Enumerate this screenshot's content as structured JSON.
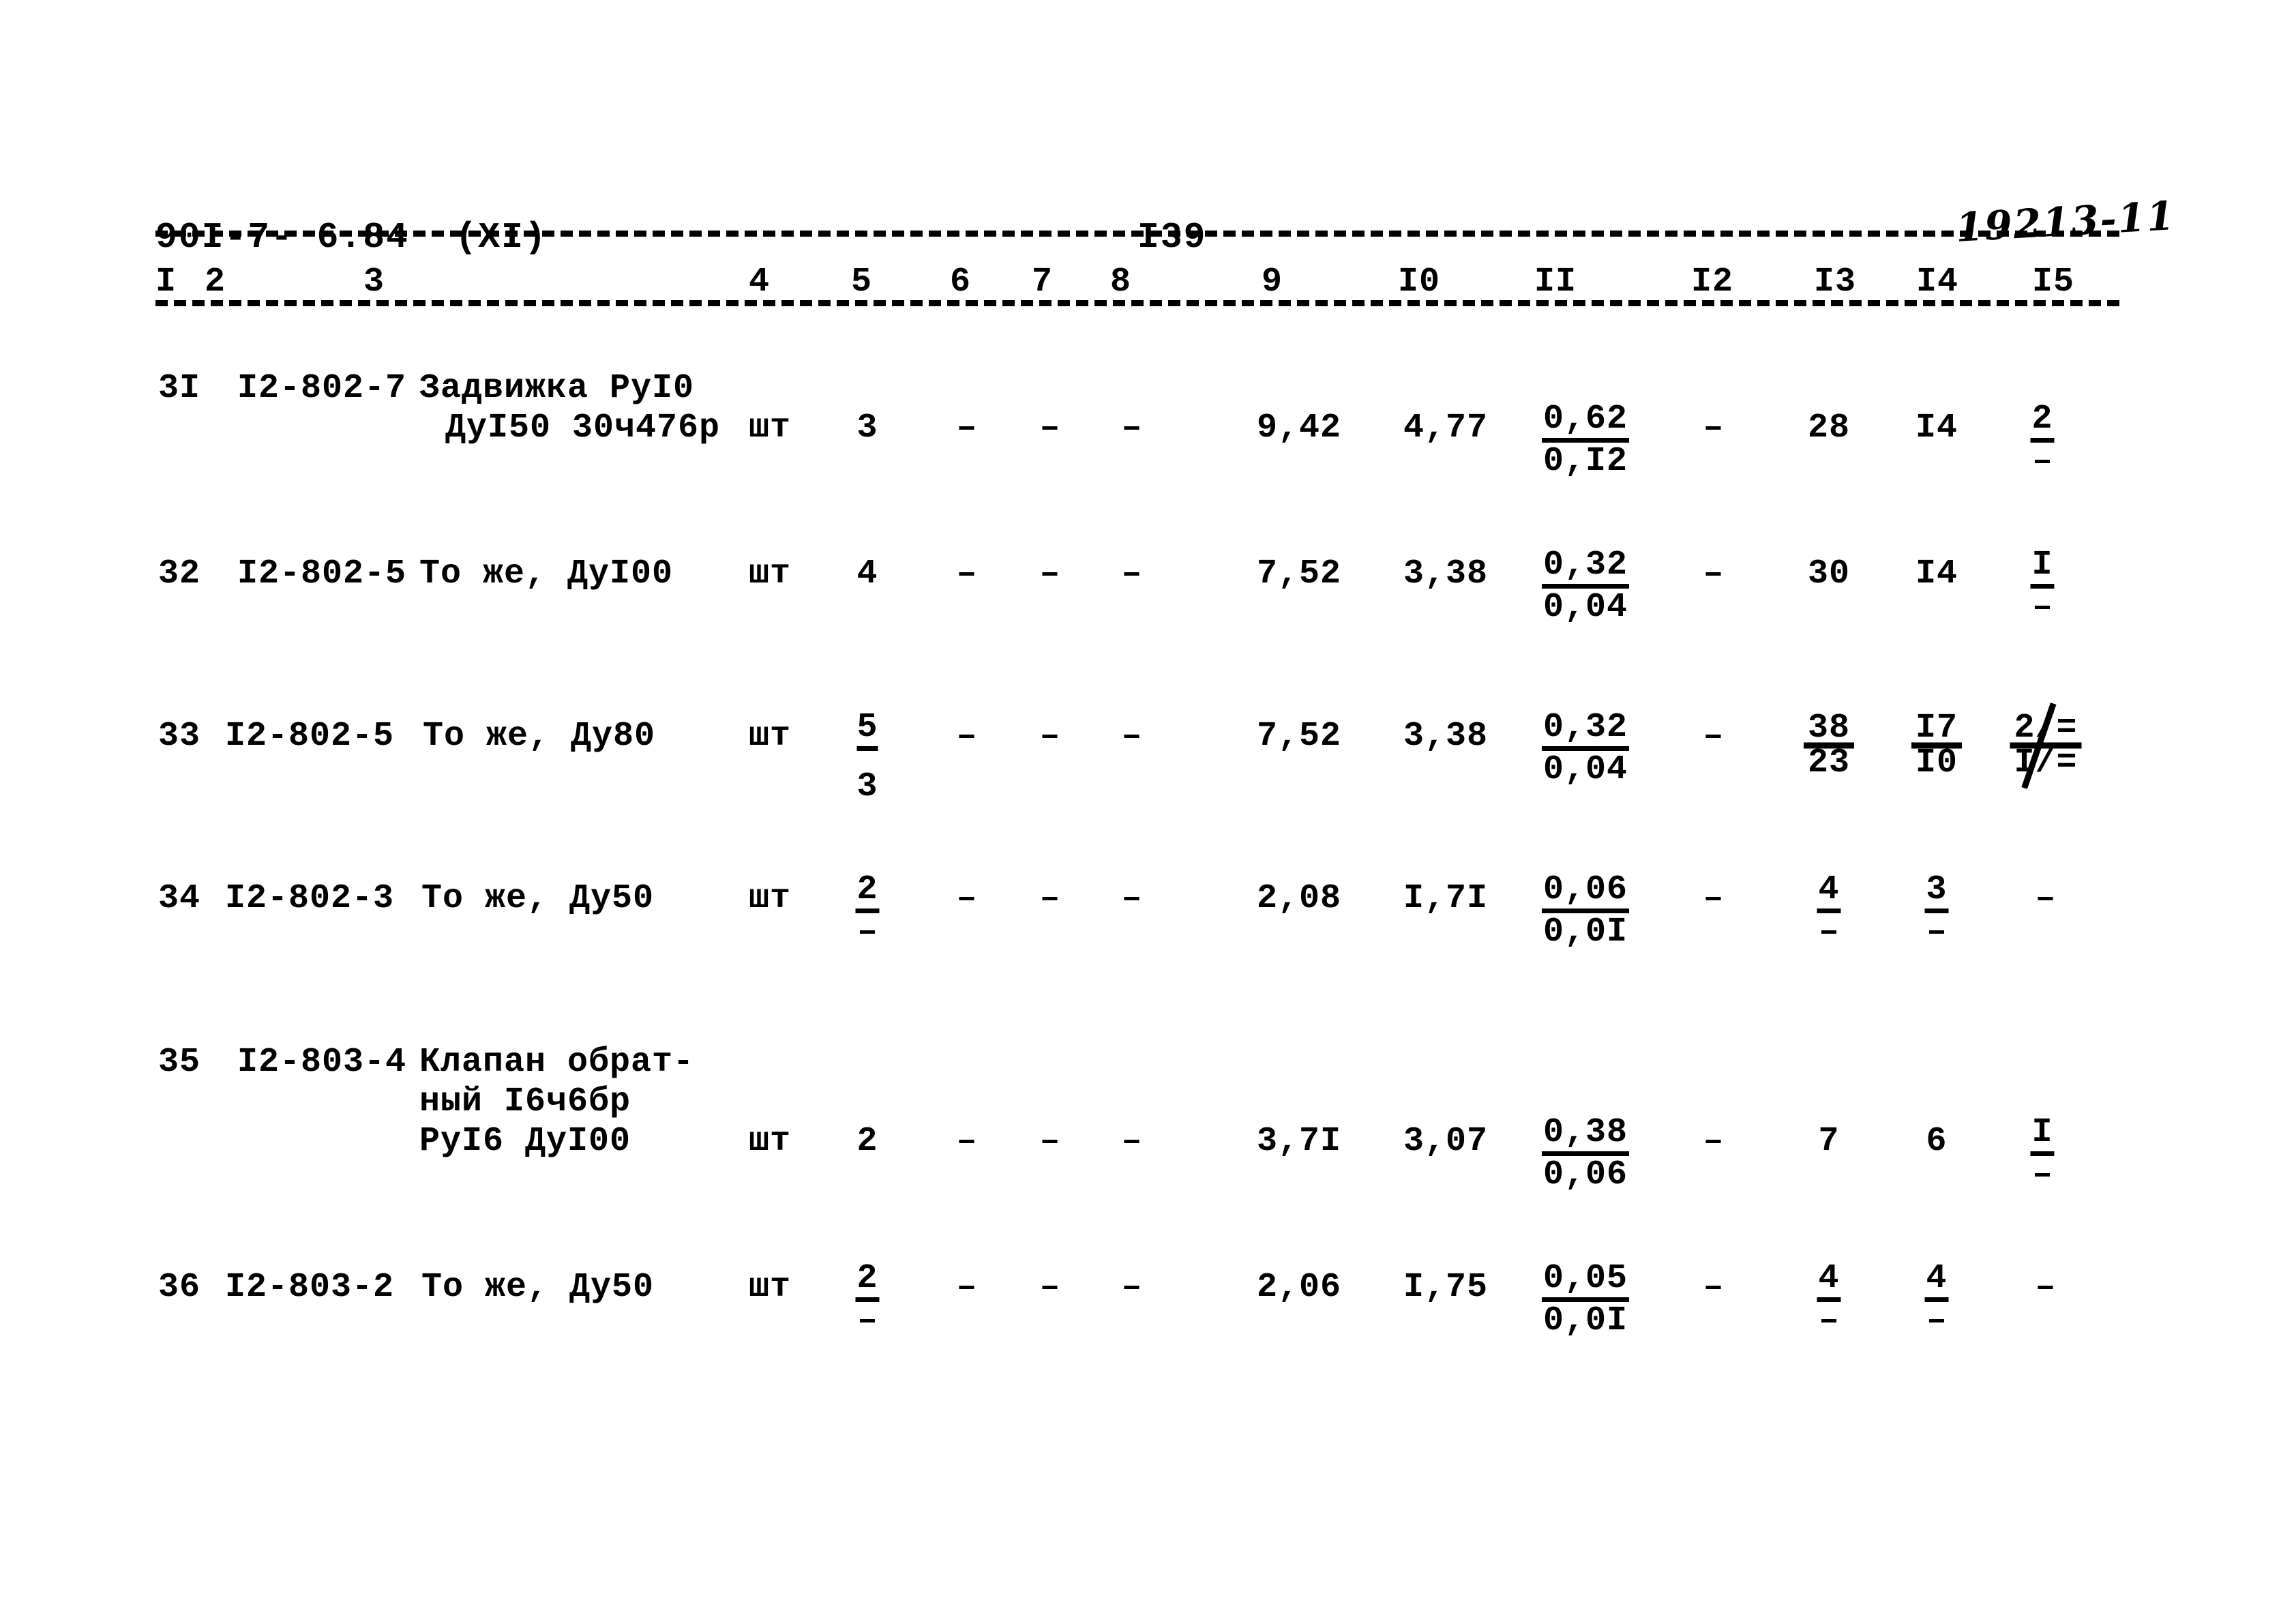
{
  "header": {
    "doc_code": "90I-7- 6.84  (XI)",
    "page_number": "I39",
    "handwritten_note": "19213-11"
  },
  "table": {
    "column_numbers": [
      "I",
      "2",
      "3",
      "4",
      "5",
      "6",
      "7",
      "8",
      "9",
      "I0",
      "II",
      "I2",
      "I3",
      "I4",
      "I5"
    ],
    "rows": [
      {
        "num": "3I",
        "code": "I2-802-7",
        "desc_line1": "Задвижка РуI0",
        "desc_line2": "ДуI50 30ч476р",
        "unit": "шт",
        "c5": "3",
        "c6": "–",
        "c7": "–",
        "c8": "–",
        "c9": "9,42",
        "c10": "4,77",
        "c11_num": "0,62",
        "c11_den": "0,I2",
        "c12": "–",
        "c13": "28",
        "c14": "I4",
        "c15_num": "2",
        "c15_den": "–"
      },
      {
        "num": "32",
        "code": "I2-802-5",
        "desc_line1": "То же, ДуI00",
        "desc_line2": "",
        "unit": "шт",
        "c5": "4",
        "c6": "–",
        "c7": "–",
        "c8": "–",
        "c9": "7,52",
        "c10": "3,38",
        "c11_num": "0,32",
        "c11_den": "0,04",
        "c12": "–",
        "c13": "30",
        "c14": "I4",
        "c15_num": "I",
        "c15_den": "–"
      },
      {
        "num": "33",
        "code": "I2-802-5",
        "desc_line1": "То же, Ду80",
        "desc_line2": "",
        "unit": "шт",
        "c5_top": "5",
        "c5_bot": "3",
        "c6": "–",
        "c7": "–",
        "c8": "–",
        "c9": "7,52",
        "c10": "3,38",
        "c11_num": "0,32",
        "c11_den": "0,04",
        "c12": "–",
        "c13_old": "38",
        "c13_new": "23",
        "c14_old": "I7",
        "c14_new": "I0",
        "c15_old": "2/=",
        "c15_new": "I/="
      },
      {
        "num": "34",
        "code": "I2-802-3",
        "desc_line1": "То же, Ду50",
        "desc_line2": "",
        "unit": "шт",
        "c5_num": "2",
        "c5_den": "–",
        "c6": "–",
        "c7": "–",
        "c8": "–",
        "c9": "2,08",
        "c10": "I,7I",
        "c11_num": "0,06",
        "c11_den": "0,0I",
        "c12": "–",
        "c13_num": "4",
        "c13_den": "–",
        "c14_num": "3",
        "c14_den": "–",
        "c15": "–"
      },
      {
        "num": "35",
        "code": "I2-803-4",
        "desc_line1": "Клапан обрат-",
        "desc_line2": "ный I6ч6бр",
        "desc_line3": "РуI6 ДуI00",
        "unit": "шт",
        "c5": "2",
        "c6": "–",
        "c7": "–",
        "c8": "–",
        "c9": "3,7I",
        "c10": "3,07",
        "c11_num": "0,38",
        "c11_den": "0,06",
        "c12": "–",
        "c13": "7",
        "c14": "6",
        "c15_num": "I",
        "c15_den": "–"
      },
      {
        "num": "36",
        "code": "I2-803-2",
        "desc_line1": "То же, Ду50",
        "desc_line2": "",
        "unit": "шт",
        "c5_num": "2",
        "c5_den": "–",
        "c6": "–",
        "c7": "–",
        "c8": "–",
        "c9": "2,06",
        "c10": "I,75",
        "c11_num": "0,05",
        "c11_den": "0,0I",
        "c12": "–",
        "c13_num": "4",
        "c13_den": "–",
        "c14_num": "4",
        "c14_den": "–",
        "c15": "–"
      }
    ]
  }
}
